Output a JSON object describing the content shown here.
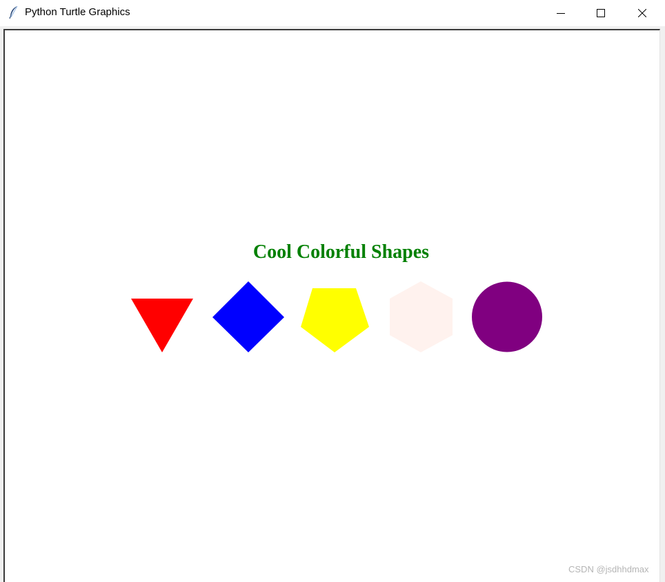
{
  "window": {
    "title": "Python Turtle Graphics",
    "app_icon": "feather-icon",
    "controls": {
      "minimize": "minimize-icon",
      "maximize": "maximize-icon",
      "close": "close-icon"
    }
  },
  "canvas": {
    "heading": {
      "text": "Cool Colorful Shapes",
      "color": "#008000"
    },
    "shapes": [
      {
        "name": "triangle",
        "sides": 3,
        "color": "#ff0000"
      },
      {
        "name": "square",
        "sides": 4,
        "color": "#0000ff"
      },
      {
        "name": "pentagon",
        "sides": 5,
        "color": "#ffff00"
      },
      {
        "name": "hexagon",
        "sides": 6,
        "color": "#fff2ee"
      },
      {
        "name": "circle",
        "sides": 0,
        "color": "#800080"
      }
    ]
  },
  "watermark": "CSDN @jsdhhdmax"
}
